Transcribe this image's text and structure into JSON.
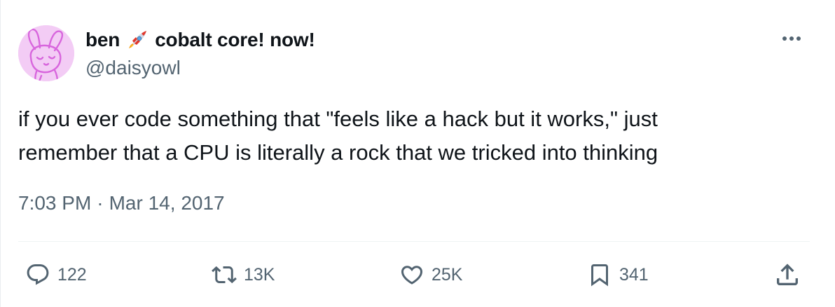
{
  "author": {
    "display_name": "ben",
    "name_suffix": "cobalt core! now!",
    "handle": "@daisyowl",
    "name_emoji_icon": "rocket-icon",
    "avatar_color": "#f3ccf5"
  },
  "tweet": {
    "lines": [
      "if you ever code something that \"feels like a hack but it works,\" just",
      "remember that a CPU is literally a rock that we tricked into thinking"
    ],
    "time": "7:03 PM",
    "separator": "·",
    "date": "Mar 14, 2017"
  },
  "actions": {
    "replies": {
      "icon": "reply-icon",
      "count": "122"
    },
    "reposts": {
      "icon": "repost-icon",
      "count": "13K"
    },
    "likes": {
      "icon": "heart-icon",
      "count": "25K"
    },
    "bookmarks": {
      "icon": "bookmark-icon",
      "count": "341"
    },
    "share": {
      "icon": "share-icon"
    },
    "more": {
      "icon": "more-icon"
    }
  },
  "colors": {
    "text": "#0f1419",
    "secondary_text": "#536471",
    "divider": "#eff3f4",
    "background": "#ffffff"
  }
}
